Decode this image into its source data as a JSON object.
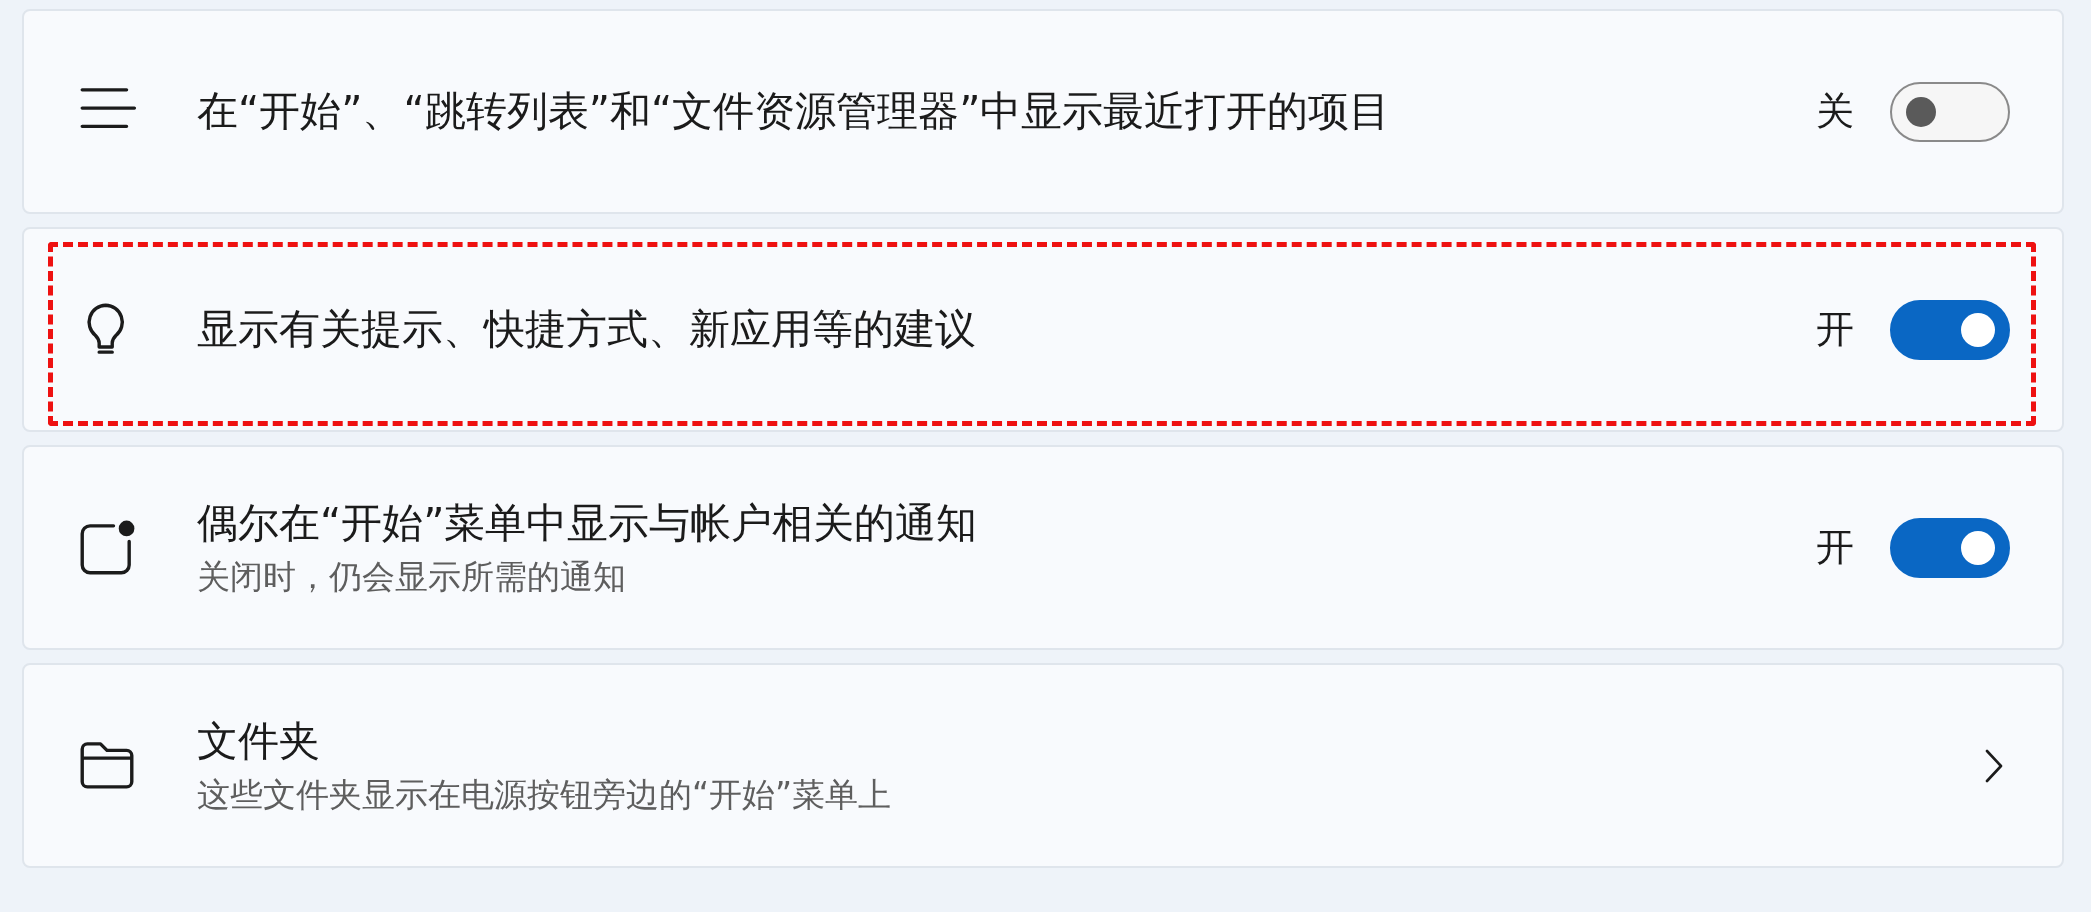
{
  "settings": [
    {
      "kind": "toggle",
      "title": "在“开始”、“跳转列表”和“文件资源管理器”中显示最近打开的项目",
      "state_label": "关",
      "on": false,
      "highlighted": false
    },
    {
      "kind": "toggle",
      "title": "显示有关提示、快捷方式、新应用等的建议",
      "state_label": "开",
      "on": true,
      "highlighted": true
    },
    {
      "kind": "toggle",
      "title": "偶尔在“开始”菜单中显示与帐户相关的通知",
      "subtitle": "关闭时，仍会显示所需的通知",
      "state_label": "开",
      "on": true,
      "highlighted": false
    },
    {
      "kind": "link",
      "title": "文件夹",
      "subtitle": "这些文件夹显示在电源按钮旁边的“开始”菜单上",
      "highlighted": false
    }
  ]
}
